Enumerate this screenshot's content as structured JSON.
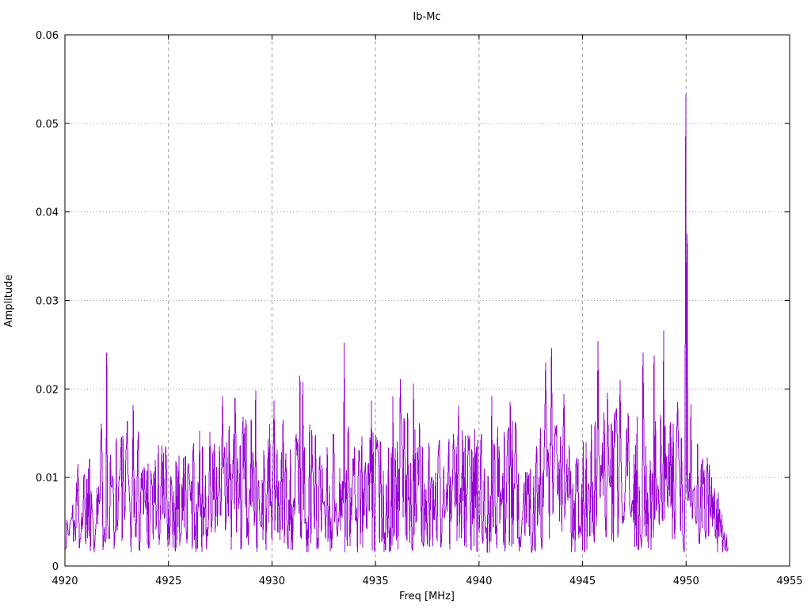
{
  "chart_data": {
    "type": "line",
    "title": "Ib-Mc",
    "xlabel": "Freq [MHz]",
    "ylabel": "Amplitude",
    "xlim": [
      4920,
      4955
    ],
    "ylim": [
      0,
      0.06
    ],
    "xticks": [
      4920,
      4925,
      4930,
      4935,
      4940,
      4945,
      4950,
      4955
    ],
    "yticks": [
      0,
      0.01,
      0.02,
      0.03,
      0.04,
      0.05,
      0.06
    ],
    "grid": true,
    "legend_position": "none",
    "line_color": "#9400d3",
    "grid_color": "#9b9b9b",
    "background_color": "#ffffff",
    "series": [
      {
        "name": "Ib-Mc",
        "style": "noisy-spectrum-line",
        "x_start": 4920.02,
        "x_end": 4952.05,
        "n_points": 900,
        "noise_floor": 0.0015,
        "distribution_power": 1.25,
        "seed": 1337,
        "envelope_breakpoints": [
          [
            4920.0,
            0.005
          ],
          [
            4920.4,
            0.011
          ],
          [
            4921.0,
            0.015
          ],
          [
            4921.8,
            0.017
          ],
          [
            4922.3,
            0.018
          ],
          [
            4923.0,
            0.017
          ],
          [
            4924.0,
            0.0165
          ],
          [
            4925.0,
            0.015
          ],
          [
            4926.0,
            0.015
          ],
          [
            4927.0,
            0.016
          ],
          [
            4928.0,
            0.017
          ],
          [
            4929.0,
            0.017
          ],
          [
            4930.0,
            0.016
          ],
          [
            4931.0,
            0.017
          ],
          [
            4932.0,
            0.016
          ],
          [
            4933.0,
            0.016
          ],
          [
            4933.6,
            0.017
          ],
          [
            4934.5,
            0.015
          ],
          [
            4935.5,
            0.016
          ],
          [
            4936.5,
            0.018
          ],
          [
            4937.5,
            0.015
          ],
          [
            4938.5,
            0.016
          ],
          [
            4939.5,
            0.016
          ],
          [
            4940.5,
            0.016
          ],
          [
            4941.5,
            0.017
          ],
          [
            4942.5,
            0.016
          ],
          [
            4943.5,
            0.018
          ],
          [
            4944.5,
            0.016
          ],
          [
            4945.5,
            0.017
          ],
          [
            4946.5,
            0.018
          ],
          [
            4947.5,
            0.017
          ],
          [
            4948.5,
            0.018
          ],
          [
            4949.5,
            0.017
          ],
          [
            4950.5,
            0.015
          ],
          [
            4951.0,
            0.013
          ],
          [
            4951.5,
            0.009
          ],
          [
            4952.0,
            0.004
          ],
          [
            4952.1,
            0.002
          ]
        ],
        "major_peaks": [
          [
            4922.0,
            0.0241
          ],
          [
            4923.3,
            0.0182
          ],
          [
            4927.6,
            0.0192
          ],
          [
            4928.2,
            0.019
          ],
          [
            4929.2,
            0.0198
          ],
          [
            4930.1,
            0.0187
          ],
          [
            4931.35,
            0.0215
          ],
          [
            4931.5,
            0.0208
          ],
          [
            4933.5,
            0.0252
          ],
          [
            4934.8,
            0.0187
          ],
          [
            4935.85,
            0.0192
          ],
          [
            4936.2,
            0.0211
          ],
          [
            4936.85,
            0.0206
          ],
          [
            4939.0,
            0.0181
          ],
          [
            4940.6,
            0.0192
          ],
          [
            4941.5,
            0.0185
          ],
          [
            4943.2,
            0.023
          ],
          [
            4943.5,
            0.0246
          ],
          [
            4944.1,
            0.0194
          ],
          [
            4945.75,
            0.0254
          ],
          [
            4946.2,
            0.0196
          ],
          [
            4946.8,
            0.021
          ],
          [
            4947.9,
            0.0241
          ],
          [
            4948.45,
            0.0238
          ],
          [
            4948.9,
            0.0266
          ],
          [
            4949.6,
            0.0185
          ],
          [
            4949.98,
            0.0533
          ],
          [
            4950.05,
            0.0375
          ],
          [
            4950.25,
            0.0183
          ]
        ]
      }
    ]
  }
}
